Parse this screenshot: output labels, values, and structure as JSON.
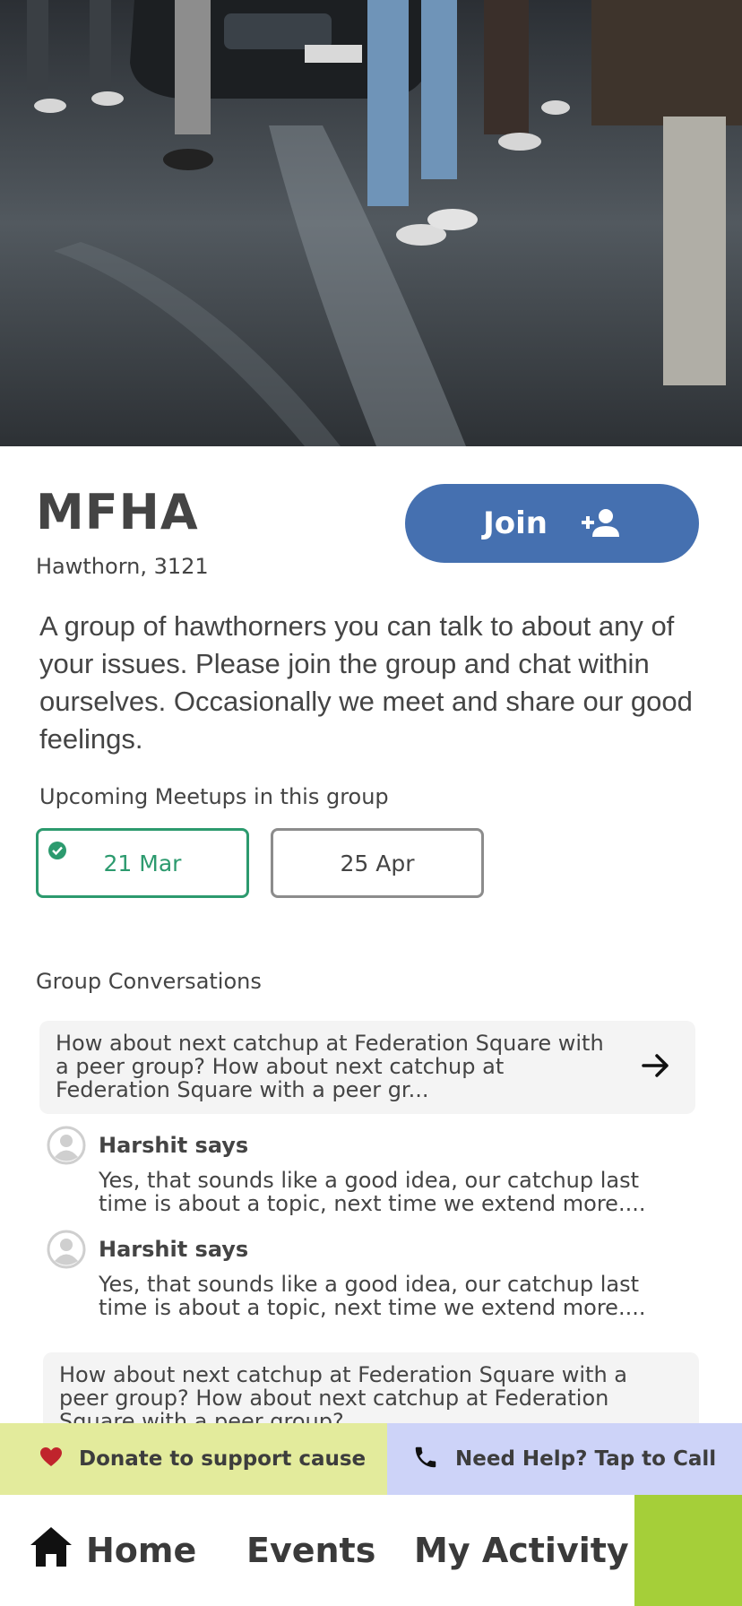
{
  "hero": {
    "image_alt": "People standing on a wet street at night near a car"
  },
  "group": {
    "title": "MFHA",
    "location": "Hawthorn, 3121",
    "join_label": "Join",
    "description": "A group of hawthorners you can talk to about any of your issues. Please join the group and chat within ourselves. Occasionally we meet and share our good feelings."
  },
  "meetups": {
    "heading": "Upcoming Meetups in this group",
    "dates": [
      {
        "label": "21 Mar",
        "selected": true
      },
      {
        "label": "25 Apr",
        "selected": false
      }
    ]
  },
  "conversations": {
    "heading": "Group Conversations",
    "threads": [
      {
        "text": "How about next catchup at Federation Square with a peer group? How about next catchup at Federation Square with a peer gr...",
        "replies": [
          {
            "author": "Harshit says",
            "text": "Yes, that sounds like a good idea, our catchup last time is about a topic, next time we extend more...."
          },
          {
            "author": "Harshit says",
            "text": "Yes, that sounds like a good idea, our catchup last time is about a topic, next time we extend more...."
          }
        ]
      },
      {
        "text": "How about next catchup at Federation Square with a peer group? How about next catchup at Federation Square with a peer group?"
      }
    ]
  },
  "actions": {
    "donate_label": "Donate to support cause",
    "help_label": "Need Help? Tap to Call"
  },
  "nav": {
    "home": "Home",
    "events": "Events",
    "activity": "My Activity"
  },
  "colors": {
    "primary": "#4570b0",
    "selected_green": "#2c9a6e",
    "donate_bg": "#e3eb9c",
    "help_bg": "#cdd3f8",
    "nav_accent": "#a5cf39",
    "heart": "#c0242c"
  }
}
